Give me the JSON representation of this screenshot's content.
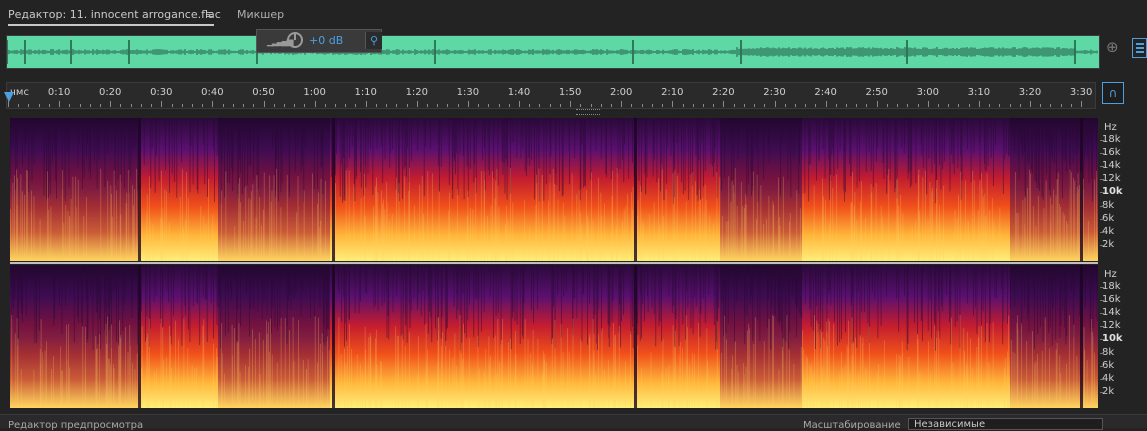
{
  "tabs": {
    "editor": "Редактор: 11. innocent arrogance.flac",
    "menu": "≡",
    "mixer": "Микшер"
  },
  "hud": {
    "level_icon": "level-meter-icon",
    "gain": "+0 dB",
    "pin_icon": "pin-icon",
    "pin_glyph": "⚲"
  },
  "timeline": {
    "format_label": "чмс",
    "ticks": [
      "0:10",
      "0:20",
      "0:30",
      "0:40",
      "0:50",
      "1:00",
      "1:10",
      "1:20",
      "1:30",
      "1:40",
      "1:50",
      "2:00",
      "2:10",
      "2:20",
      "2:30",
      "2:40",
      "2:50",
      "3:00",
      "3:10",
      "3:20",
      "3:30"
    ]
  },
  "snap_glyph": "∩",
  "freq_axis": {
    "unit": "Hz",
    "labels": [
      "18k",
      "16k",
      "14k",
      "12k",
      "10k",
      "8k",
      "6k",
      "4k",
      "2k"
    ]
  },
  "footer": {
    "preview_editor": "Редактор предпросмотра",
    "scaling_label": "Масштабирование",
    "scaling_value": "Независимые"
  },
  "colors": {
    "waveform": "#5ed9a6",
    "accent": "#4d9fe0"
  }
}
